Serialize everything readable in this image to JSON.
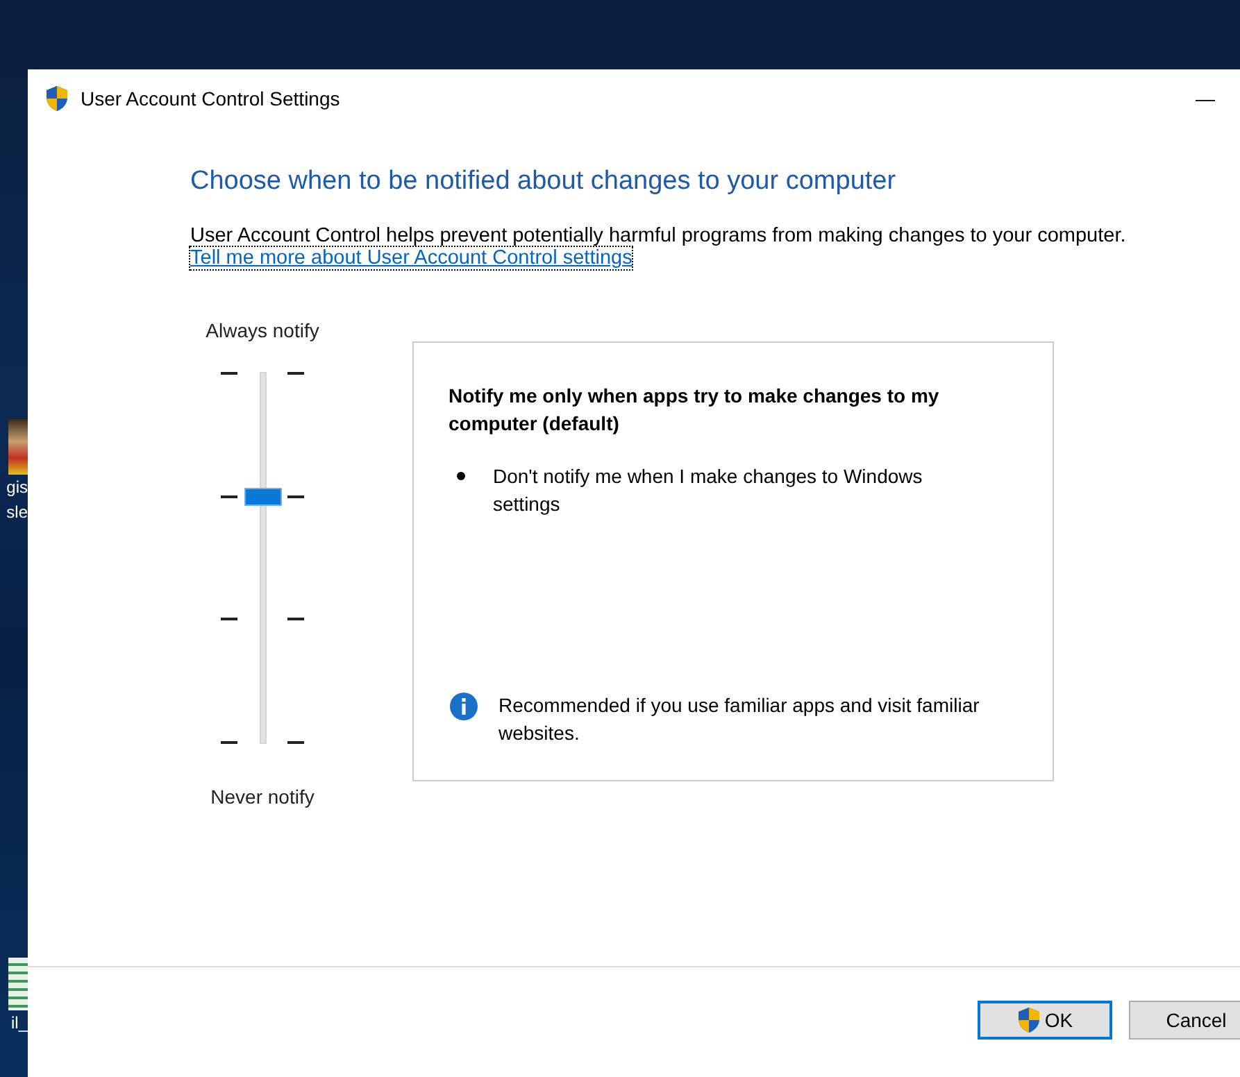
{
  "desktop": {
    "icons": [
      {
        "lines": [
          "gis",
          "sle"
        ]
      },
      {
        "lines": [
          "il_"
        ]
      }
    ]
  },
  "window": {
    "title": "User Account Control Settings",
    "minimize": "—"
  },
  "heading": "Choose when to be notified about changes to your computer",
  "description": "User Account Control helps prevent potentially harmful programs from making changes to your computer.",
  "link": "Tell me more about User Account Control settings",
  "slider": {
    "top_label": "Always notify",
    "bottom_label": "Never notify",
    "level": 0.6667
  },
  "panel": {
    "title": "Notify me only when apps try to make changes to my computer (default)",
    "bullets": [
      "Don't notify me when I make changes to Windows settings"
    ],
    "info": "Recommended if you use familiar apps and visit familiar websites."
  },
  "buttons": [
    {
      "label": "OK",
      "kind": "shield",
      "default": true
    },
    {
      "label": "Cancel",
      "kind": "plain",
      "default": false
    }
  ]
}
